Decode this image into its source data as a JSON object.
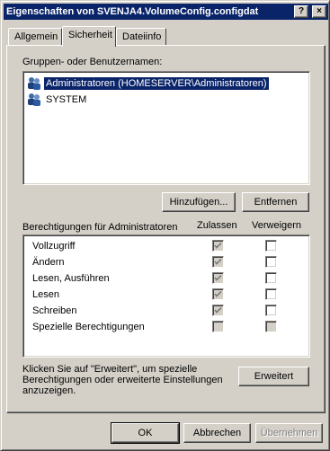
{
  "window": {
    "title": "Eigenschaften von SVENJA4.VolumeConfig.configdat",
    "help_glyph": "?",
    "close_glyph": "×"
  },
  "tabs": [
    {
      "label": "Allgemein",
      "active": false
    },
    {
      "label": "Sicherheit",
      "active": true
    },
    {
      "label": "Dateiinfo",
      "active": false
    }
  ],
  "security": {
    "groups_label": "Gruppen- oder Benutzernamen:",
    "users": [
      {
        "name": "Administratoren (HOMESERVER\\Administratoren)",
        "icon": "user-group-icon",
        "selected": true
      },
      {
        "name": "SYSTEM",
        "icon": "user-group-icon",
        "selected": false
      }
    ],
    "add_button": "Hinzufügen...",
    "remove_button": "Entfernen",
    "permissions_label": "Berechtigungen für Administratoren",
    "col_allow": "Zulassen",
    "col_deny": "Verweigern",
    "permissions": [
      {
        "name": "Vollzugriff",
        "allow": true,
        "deny": false,
        "disabled": false
      },
      {
        "name": "Ändern",
        "allow": true,
        "deny": false,
        "disabled": false
      },
      {
        "name": "Lesen, Ausführen",
        "allow": true,
        "deny": false,
        "disabled": false
      },
      {
        "name": "Lesen",
        "allow": true,
        "deny": false,
        "disabled": false
      },
      {
        "name": "Schreiben",
        "allow": true,
        "deny": false,
        "disabled": false
      },
      {
        "name": "Spezielle Berechtigungen",
        "allow": false,
        "deny": false,
        "disabled": true
      }
    ],
    "advanced_hint": "Klicken Sie auf \"Erweitert\", um spezielle Berechtigungen oder erweiterte Einstellungen anzuzeigen.",
    "advanced_button": "Erweitert"
  },
  "footer": {
    "ok": "OK",
    "cancel": "Abbrechen",
    "apply": "Übernehmen"
  }
}
